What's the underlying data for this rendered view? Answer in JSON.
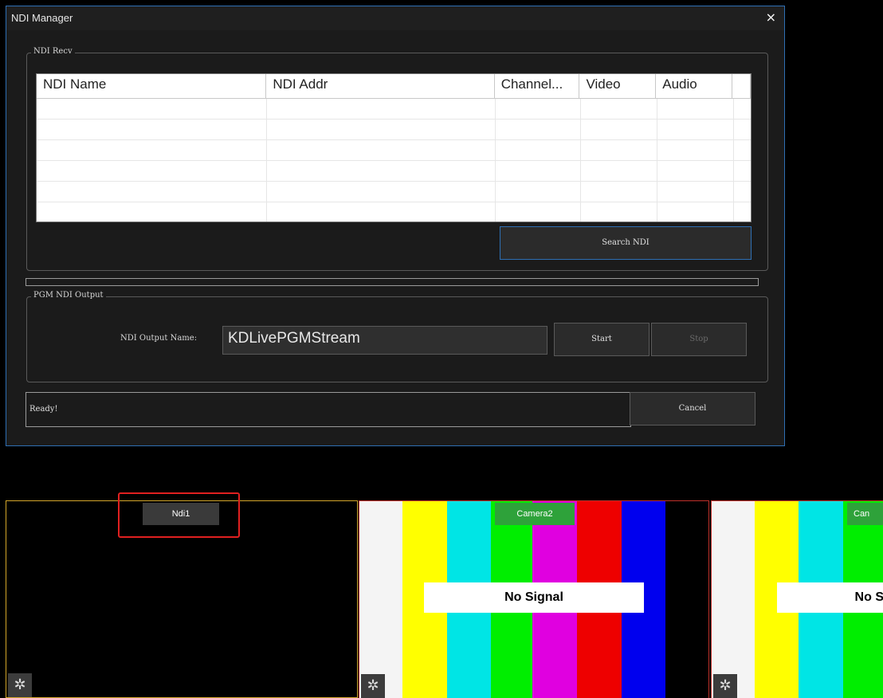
{
  "dialog": {
    "title": "NDI Manager",
    "close_label": "×",
    "recv_group_label": "NDI Recv",
    "columns": [
      "NDI Name",
      "NDI Addr",
      "Channel...",
      "Video",
      "Audio"
    ],
    "rows": [
      [
        "",
        "",
        "",
        "",
        ""
      ],
      [
        "",
        "",
        "",
        "",
        ""
      ],
      [
        "",
        "",
        "",
        "",
        ""
      ],
      [
        "",
        "",
        "",
        "",
        ""
      ],
      [
        "",
        "",
        "",
        "",
        ""
      ],
      [
        "",
        "",
        "",
        "",
        ""
      ]
    ],
    "search_button": "Search NDI",
    "progress": 0,
    "output_group_label": "PGM NDI Output",
    "output_name_label": "NDI Output Name:",
    "output_name_value": "KDLivePGMStream",
    "start_button": "Start",
    "stop_button": "Stop",
    "status_text": "Ready!",
    "cancel_button": "Cancel"
  },
  "previews": [
    {
      "name": "Ndi1",
      "signal": ""
    },
    {
      "name": "Camera2",
      "signal": "No Signal"
    },
    {
      "name": "Can",
      "signal": "No S"
    }
  ],
  "colors": {
    "accent": "#2e6fb4",
    "selected_border": "#d4a62a",
    "highlight_box": "#e02020",
    "bars": [
      "#f4f4f4",
      "#ffff00",
      "#00e5e5",
      "#00ee00",
      "#e000e0",
      "#ee0000",
      "#0000ee",
      "#000000"
    ]
  },
  "icons": {
    "gear": "gear-icon",
    "close": "close-icon"
  }
}
